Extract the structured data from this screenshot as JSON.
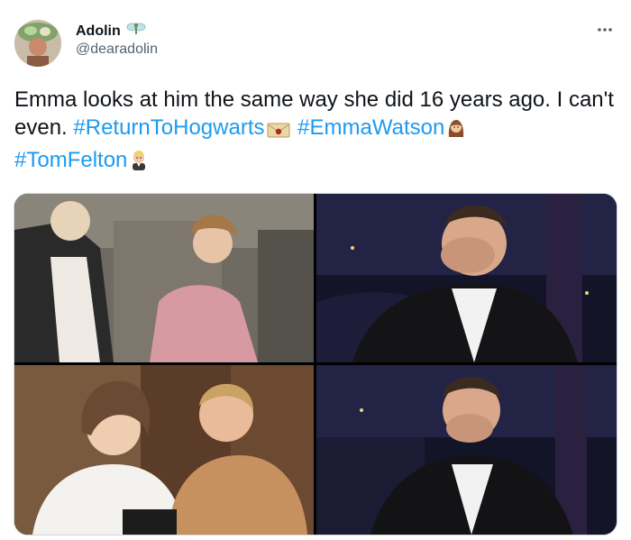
{
  "author": {
    "display_name": "Adolin",
    "handle": "@dearadolin",
    "avatar_icon": "avatar-photo",
    "name_emoji": "fairy-icon"
  },
  "tweet": {
    "text_part1": "Emma looks at him the same way she did 16 years ago. I can't even. ",
    "hashtag1": "#ReturnToHogwarts",
    "hashtag2": "#EmmaWatson",
    "hashtag3": "#TomFelton",
    "emoji1": "envelope-with-seal-icon",
    "emoji2": "woman-brown-hair-icon",
    "emoji3": "blond-person-icon"
  },
  "colors": {
    "link": "#1d9bf0",
    "text": "#0f1419",
    "secondary": "#536471"
  },
  "media": [
    {
      "name": "photo-yule-ball"
    },
    {
      "name": "photo-host-covering-eyes"
    },
    {
      "name": "photo-emma-tom-reunion"
    },
    {
      "name": "photo-host-covering-mouth"
    }
  ]
}
